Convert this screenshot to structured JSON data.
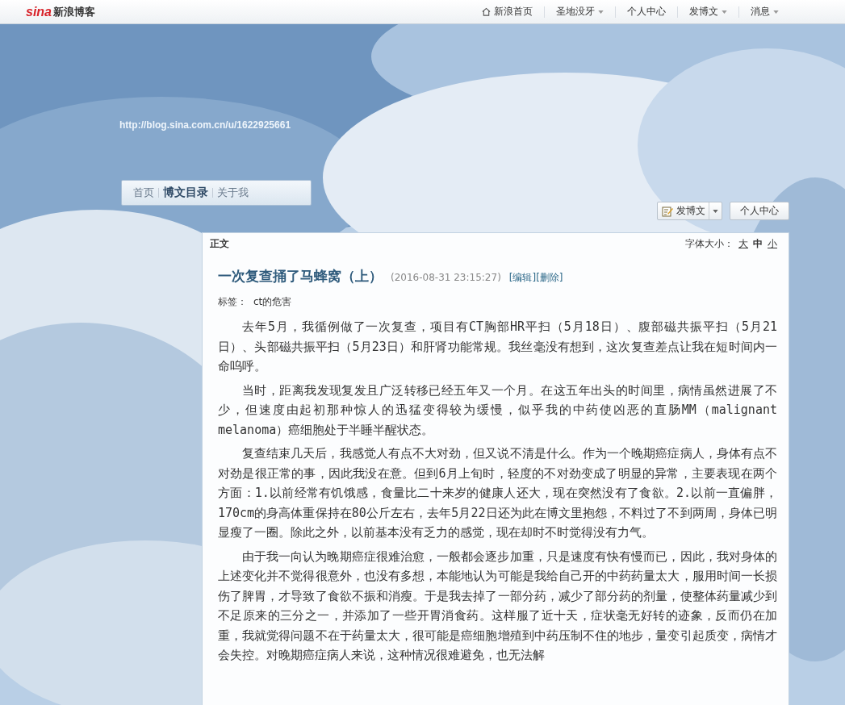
{
  "top_bar": {
    "logo_mark": "sina",
    "logo_text": "新浪博客",
    "links": [
      {
        "label": "新浪首页",
        "kind": "home",
        "has_menu": false
      },
      {
        "label": "圣地没牙",
        "has_menu": true
      },
      {
        "label": "个人中心",
        "has_menu": false
      },
      {
        "label": "发博文",
        "has_menu": true
      },
      {
        "label": "消息",
        "has_menu": true
      }
    ]
  },
  "blog_url": "http://blog.sina.com.cn/u/1622925661",
  "blog_nav": [
    {
      "label": "首页",
      "selected": false
    },
    {
      "label": "博文目录",
      "selected": true
    },
    {
      "label": "关于我",
      "selected": false
    }
  ],
  "actions": [
    {
      "label": "发博文",
      "kind": "post",
      "has_menu": true
    },
    {
      "label": "个人中心",
      "kind": "plain",
      "has_menu": false
    }
  ],
  "article": {
    "section": "正文",
    "font_size_label": "字体大小：",
    "font_sizes": [
      {
        "label": "大",
        "selected": false
      },
      {
        "label": "中",
        "selected": true
      },
      {
        "label": "小",
        "selected": false
      }
    ],
    "title": "一次复查捅了马蜂窝（上）",
    "date": "(2016-08-31 23:15:27)",
    "edit_links": [
      "[编辑]",
      "[删除]"
    ],
    "tags_label": "标签：",
    "tags": [
      "ct的危害"
    ],
    "paragraphs": [
      "去年5月，我循例做了一次复查，项目有CT胸部HR平扫（5月18日）、腹部磁共振平扫（5月21日）、头部磁共振平扫（5月23日）和肝肾功能常规。我丝毫没有想到，这次复查差点让我在短时间内一命呜呼。",
      "当时，距离我发现复发且广泛转移已经五年又一个月。在这五年出头的时间里，病情虽然进展了不少，但速度由起初那种惊人的迅猛变得较为缓慢，似乎我的中药使凶恶的直肠MM（malignant melanoma）癌细胞处于半睡半醒状态。",
      "复查结束几天后，我感觉人有点不大对劲，但又说不清是什么。作为一个晚期癌症病人，身体有点不对劲是很正常的事，因此我没在意。但到6月上旬时，轻度的不对劲变成了明显的异常，主要表现在两个方面：1.以前经常有饥饿感，食量比二十来岁的健康人还大，现在突然没有了食欲。2.以前一直偏胖，170cm的身高体重保持在80公斤左右，去年5月22日还为此在博文里抱怨，不料过了不到两周，身体已明显瘦了一圈。除此之外，以前基本没有乏力的感觉，现在却时不时觉得没有力气。",
      "由于我一向认为晚期癌症很难治愈，一般都会逐步加重，只是速度有快有慢而已，因此，我对身体的上述变化并不觉得很意外，也没有多想，本能地认为可能是我给自己开的中药药量太大，服用时间一长损伤了脾胃，才导致了食欲不振和消瘦。于是我去掉了一部分药，减少了部分药的剂量，使整体药量减少到不足原来的三分之一，并添加了一些开胃消食药。这样服了近十天，症状毫无好转的迹象，反而仍在加重，我就觉得问题不在于药量太大，很可能是癌细胞增殖到中药压制不住的地步，量变引起质变，病情才会失控。对晚期癌症病人来说，这种情况很难避免，也无法解"
    ]
  }
}
